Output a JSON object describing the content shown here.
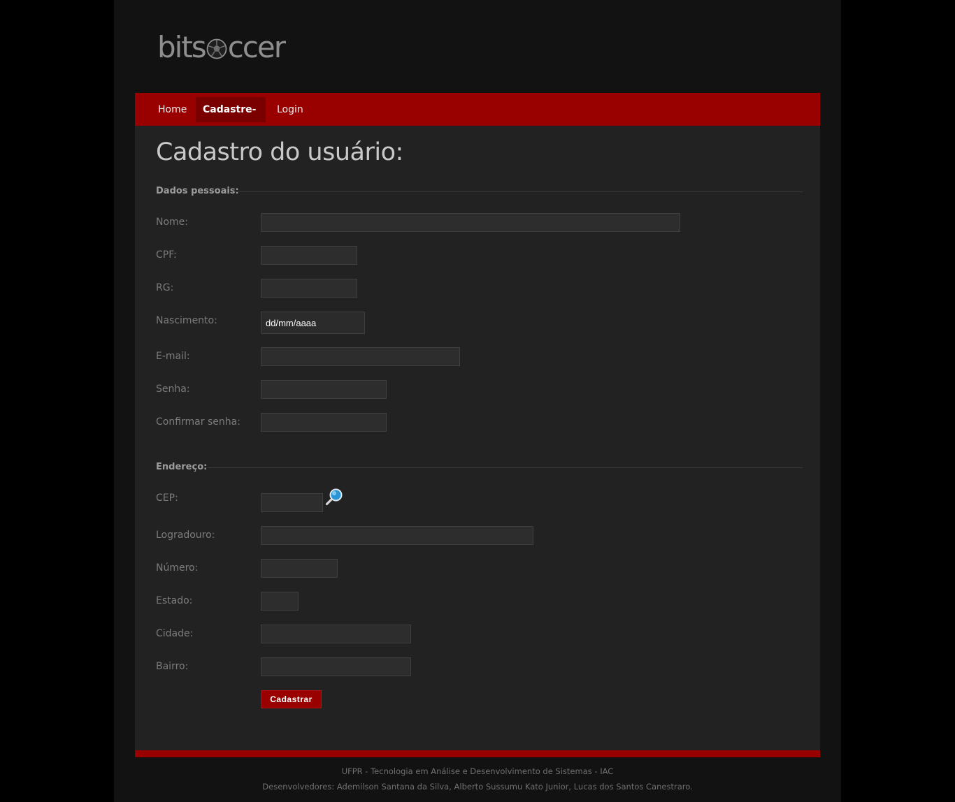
{
  "logo": {
    "text_before": "bits",
    "text_after": "ccer",
    "icon": "soccer-ball-icon"
  },
  "nav": {
    "items": [
      {
        "label": "Home",
        "active": false
      },
      {
        "label": "Cadastre-se",
        "active": true
      },
      {
        "label": "Login",
        "active": false
      }
    ]
  },
  "page": {
    "title": "Cadastro do usuário:"
  },
  "personal": {
    "legend": "Dados pessoais:",
    "nome_label": "Nome:",
    "cpf_label": "CPF:",
    "rg_label": "RG:",
    "nascimento_label": "Nascimento:",
    "nascimento_placeholder": "dd/mm/aaaa",
    "email_label": "E-mail:",
    "senha_label": "Senha:",
    "confirmar_label": "Confirmar senha:"
  },
  "address": {
    "legend": "Endereço:",
    "cep_label": "CEP:",
    "cep_search_icon": "magnifier-icon",
    "logradouro_label": "Logradouro:",
    "numero_label": "Número:",
    "estado_label": "Estado:",
    "cidade_label": "Cidade:",
    "bairro_label": "Bairro:"
  },
  "form": {
    "submit_label": "Cadastrar"
  },
  "footer": {
    "line1": "UFPR - Tecnologia em Análise e Desenvolvimento de Sistemas - IAC",
    "line2": "Desenvolvedores: Ademilson Santana da Silva, Alberto Sussumu Kato Junior, Lucas dos Santos Canestraro."
  },
  "colors": {
    "brand_red": "#990000",
    "nav_active": "#7a0000",
    "page_background": "#000000",
    "wrapper_background": "#121212",
    "content_background": "#222222"
  }
}
